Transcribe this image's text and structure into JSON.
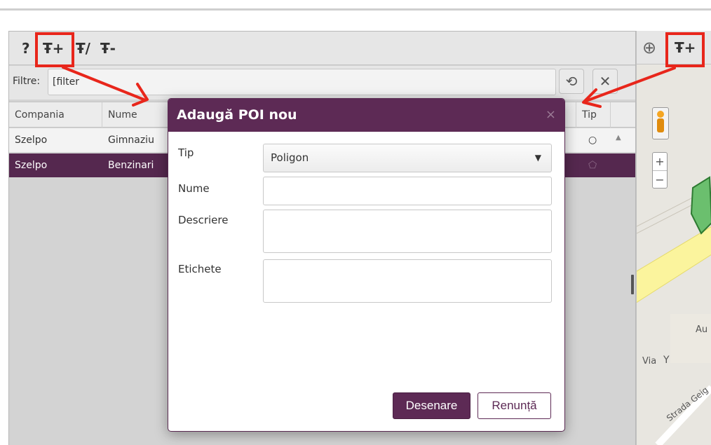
{
  "toolbar": {
    "help_icon": "?",
    "add_poi_icon": "Ŧ+",
    "edit_poi_icon": "Ŧ/",
    "remove_poi_icon": "Ŧ-"
  },
  "filter": {
    "label": "Filtre:",
    "value": "[filter"
  },
  "grid": {
    "columns": [
      "Compania",
      "Nume",
      "Tip"
    ],
    "rows": [
      {
        "company": "Szelpo",
        "name": "Gimnaziu",
        "type_icon": "○"
      },
      {
        "company": "Szelpo",
        "name": "Benzinari",
        "type_icon": "⬠"
      }
    ]
  },
  "map": {
    "locate_icon": "⊕",
    "add_poi_icon": "Ŧ+",
    "zoom_in": "+",
    "zoom_out": "−",
    "labels": {
      "au": "Au",
      "via": "Via",
      "strada": "Strada Geig"
    }
  },
  "modal": {
    "title": "Adaugă POI nou",
    "close": "×",
    "fields": {
      "tip_label": "Tip",
      "tip_value": "Poligon",
      "nume_label": "Nume",
      "nume_value": "",
      "descriere_label": "Descriere",
      "descriere_value": "",
      "etichete_label": "Etichete",
      "etichete_value": ""
    },
    "buttons": {
      "draw": "Desenare",
      "cancel": "Renunță"
    }
  },
  "colors": {
    "accent": "#5d2a55",
    "highlight": "#e8261b"
  }
}
